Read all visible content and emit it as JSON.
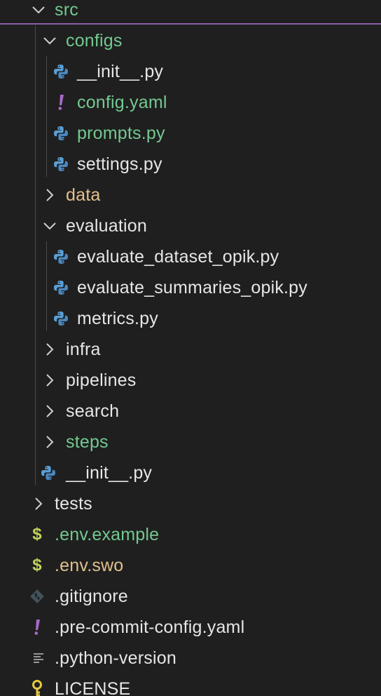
{
  "tree": {
    "src": {
      "label": "src",
      "expanded": true
    },
    "configs": {
      "label": "configs",
      "expanded": true
    },
    "configs_init": {
      "label": "__init__.py"
    },
    "config_yaml": {
      "label": "config.yaml"
    },
    "prompts": {
      "label": "prompts.py"
    },
    "settings": {
      "label": "settings.py"
    },
    "data": {
      "label": "data",
      "expanded": false
    },
    "evaluation": {
      "label": "evaluation",
      "expanded": true
    },
    "evaluate_dataset": {
      "label": "evaluate_dataset_opik.py"
    },
    "evaluate_summaries": {
      "label": "evaluate_summaries_opik.py"
    },
    "metrics": {
      "label": "metrics.py"
    },
    "infra": {
      "label": "infra",
      "expanded": false
    },
    "pipelines": {
      "label": "pipelines",
      "expanded": false
    },
    "search": {
      "label": "search",
      "expanded": false
    },
    "steps": {
      "label": "steps",
      "expanded": false
    },
    "src_init": {
      "label": "__init__.py"
    },
    "tests": {
      "label": "tests",
      "expanded": false
    },
    "env_example": {
      "label": ".env.example"
    },
    "env_swo": {
      "label": ".env.swo"
    },
    "gitignore": {
      "label": ".gitignore"
    },
    "precommit": {
      "label": ".pre-commit-config.yaml"
    },
    "python_version": {
      "label": ".python-version"
    },
    "license": {
      "label": "LICENSE"
    }
  },
  "icons": {
    "python": "python-icon",
    "yaml": "yaml-exclamation-icon",
    "env": "dollar-icon",
    "git": "git-diamond-icon",
    "text": "lines-icon",
    "license": "key-icon",
    "chevron_down": "chevron-down-icon",
    "chevron_right": "chevron-right-icon"
  },
  "colors": {
    "background": "#1f1f1f",
    "text": "#e6e6e6",
    "modified_green": "#73c991",
    "ignored_yellow": "#e2c08d",
    "python_blue": "#5a9fd4",
    "yaml_purple": "#a66bc7",
    "env_yellow_green": "#c5d25a"
  }
}
